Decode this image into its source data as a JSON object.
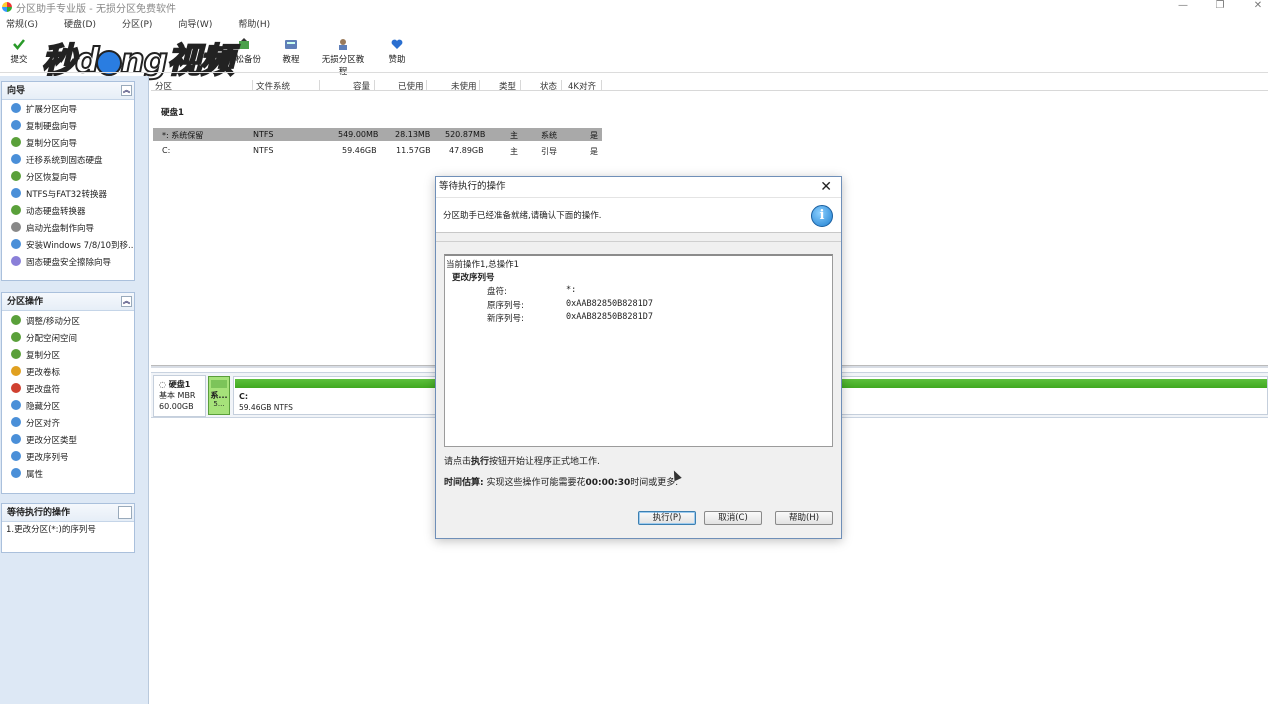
{
  "window": {
    "title": "分区助手专业版 - 无损分区免费软件",
    "controls": [
      "—",
      "❐",
      "✕"
    ]
  },
  "menu": [
    "常规(G)",
    "硬盘(D)",
    "分区(P)",
    "向导(W)",
    "帮助(H)"
  ],
  "toolbar": {
    "submit": "提交",
    "backup": "轻松备份",
    "tutorial": "教程",
    "lossless_tutorial": "无损分区教程",
    "sponsor": "赞助"
  },
  "watermark": {
    "text_a": "秒d",
    "text_b": "ng视频"
  },
  "sidebar": {
    "wizard": {
      "title": "向导",
      "items": [
        {
          "label": "扩展分区向导",
          "color": "#4a8fd8"
        },
        {
          "label": "复制硬盘向导",
          "color": "#4a8fd8"
        },
        {
          "label": "复制分区向导",
          "color": "#5aa03a"
        },
        {
          "label": "迁移系统到固态硬盘",
          "color": "#4a8fd8"
        },
        {
          "label": "分区恢复向导",
          "color": "#5aa03a"
        },
        {
          "label": "NTFS与FAT32转换器",
          "color": "#4a8fd8"
        },
        {
          "label": "动态硬盘转换器",
          "color": "#5aa03a"
        },
        {
          "label": "启动光盘制作向导",
          "color": "#888888"
        },
        {
          "label": "安装Windows 7/8/10到移...",
          "color": "#4a8fd8"
        },
        {
          "label": "固态硬盘安全擦除向导",
          "color": "#8a7fd8"
        }
      ]
    },
    "operations": {
      "title": "分区操作",
      "items": [
        {
          "label": "调整/移动分区",
          "color": "#5aa03a"
        },
        {
          "label": "分配空闲空间",
          "color": "#5aa03a"
        },
        {
          "label": "复制分区",
          "color": "#5aa03a"
        },
        {
          "label": "更改卷标",
          "color": "#e0a020"
        },
        {
          "label": "更改盘符",
          "color": "#d04030"
        },
        {
          "label": "隐藏分区",
          "color": "#4a8fd8"
        },
        {
          "label": "分区对齐",
          "color": "#4a8fd8"
        },
        {
          "label": "更改分区类型",
          "color": "#4a8fd8"
        },
        {
          "label": "更改序列号",
          "color": "#4a8fd8"
        },
        {
          "label": "属性",
          "color": "#4a8fd8"
        }
      ]
    },
    "pending": {
      "title": "等待执行的操作",
      "items": [
        "1.更改分区(*:)的序列号"
      ]
    }
  },
  "table": {
    "columns": [
      "分区",
      "文件系统",
      "容量",
      "已使用",
      "未使用",
      "类型",
      "状态",
      "4K对齐"
    ],
    "disk": "硬盘1",
    "rows": [
      {
        "name": "*: 系统保留",
        "fs": "NTFS",
        "capacity": "549.00MB",
        "used": "28.13MB",
        "free": "520.87MB",
        "type": "主",
        "status": "系统",
        "align": "是"
      },
      {
        "name": "C:",
        "fs": "NTFS",
        "capacity": "59.46GB",
        "used": "11.57GB",
        "free": "47.89GB",
        "type": "主",
        "status": "引导",
        "align": "是"
      }
    ]
  },
  "diskmap": {
    "name": "硬盘1",
    "type": "基本 MBR",
    "size": "60.00GB",
    "sys_label": "系...",
    "sys_size": "5...",
    "c_label": "C:",
    "c_info": "59.46GB NTFS"
  },
  "dialog": {
    "title": "等待执行的操作",
    "subhead": "分区助手已经准备就绪,请确认下面的操作.",
    "current": "当前操作1,总操作1",
    "op_title": "更改序列号",
    "drive_label": "盘符:",
    "drive_value": "*:",
    "old_label": "原序列号:",
    "old_value": "0xAAB82850B8281D7",
    "new_label": "新序列号:",
    "new_value": "0xAAB82850B8281D7",
    "hint_a": "请点击",
    "hint_b": "执行",
    "hint_c": "按钮开始让程序正式地工作.",
    "est_label": "时间估算:",
    "est_text": " 实现这些操作可能需要花",
    "est_time": "00:00:30",
    "est_tail": "时间或更多.",
    "btn_execute": "执行(P)",
    "btn_cancel": "取消(C)",
    "btn_help": "帮助(H)"
  }
}
